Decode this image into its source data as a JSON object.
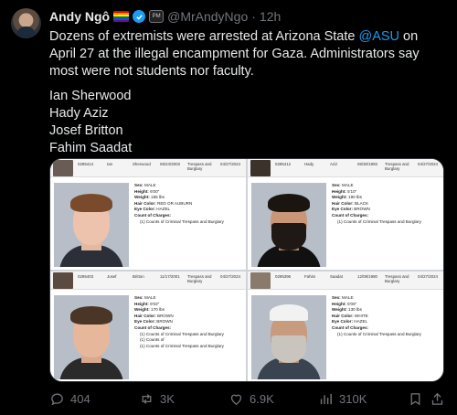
{
  "author": {
    "name": "Andy Ngô",
    "handle": "@MrAndyNgo",
    "dot": "·",
    "time": "12h",
    "org_badge": "PM"
  },
  "tweet": {
    "line1_pre": "Dozens of extremists were arrested at Arizona State ",
    "mention": "@ASU",
    "line1_post": " on April 27 at the illegal encampment for Gaza. Administrators say most were not students nor faculty.",
    "names": [
      "Ian Sherwood",
      "Hady Aziz",
      "Josef Britton",
      "Fahim Saadat"
    ]
  },
  "media": {
    "cards": [
      {
        "booking": "0295414",
        "first": "Ian",
        "last": "Sherwood",
        "dob": "06/24/2003",
        "offense": "Trespass and Burglary",
        "date": "04/27/2024",
        "sex": "MALE",
        "height": "6'00\"",
        "weight": "155 lbs",
        "hair": "RED OR AUBURN",
        "eyes": "HAZEL",
        "charges": [
          "(1) Counts of Criminal Trespass and Burglary"
        ]
      },
      {
        "booking": "0295412",
        "first": "Hady",
        "last": "Aziz",
        "dob": "06/30/1993",
        "offense": "Trespass and Burglary",
        "date": "04/27/2024",
        "sex": "MALE",
        "height": "5'10\"",
        "weight": "190 lbs",
        "hair": "BLACK",
        "eyes": "BROWN",
        "charges": [
          "(1) Counts of Criminal Trespass and Burglary"
        ]
      },
      {
        "booking": "0295403",
        "first": "Josef",
        "last": "Britton",
        "dob": "11/17/2001",
        "offense": "Trespass and Burglary",
        "date": "04/27/2024",
        "sex": "MALE",
        "height": "6'02\"",
        "weight": "170 lbs",
        "hair": "BROWN",
        "eyes": "BROWN",
        "charges": [
          "(1) Counts of Criminal Trespass and Burglary",
          "(1) Counts of",
          "(1) Counts of Criminal Trespass and Burglary"
        ]
      },
      {
        "booking": "0295396",
        "first": "Fahim",
        "last": "Saadat",
        "dob": "12/08/1980",
        "offense": "Trespass and Burglary",
        "date": "04/27/2024",
        "sex": "MALE",
        "height": "5'06\"",
        "weight": "130 lbs",
        "hair": "WHITE",
        "eyes": "HAZEL",
        "charges": [
          "(1) Counts of Criminal Trespass and Burglary"
        ]
      }
    ],
    "labels": {
      "sex": "Sex:",
      "height": "Height:",
      "weight": "Weight:",
      "hair": "Hair Color:",
      "eyes": "Eye Color:",
      "charges": "Count of Charges:"
    }
  },
  "actions": {
    "replies": "404",
    "reposts": "3K",
    "likes": "6.9K",
    "views": "310K"
  },
  "colors": {
    "accent": "#1d9bf0",
    "muted": "#71767b",
    "background": "#000000"
  }
}
